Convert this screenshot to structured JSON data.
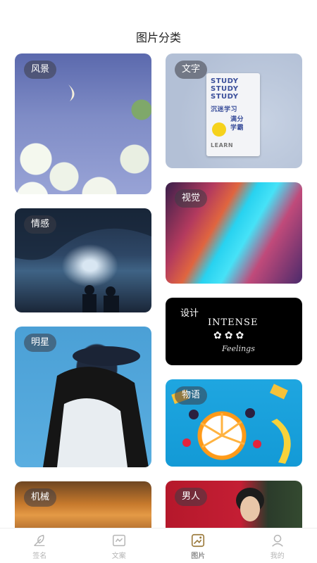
{
  "header": {
    "title": "图片分类"
  },
  "categories": [
    {
      "key": "fengjing",
      "label": "风景"
    },
    {
      "key": "wenzi",
      "label": "文字"
    },
    {
      "key": "qinggan",
      "label": "情感"
    },
    {
      "key": "shijue",
      "label": "视觉"
    },
    {
      "key": "mingxing",
      "label": "明星"
    },
    {
      "key": "sheji",
      "label": "设计"
    },
    {
      "key": "wuyu",
      "label": "物语"
    },
    {
      "key": "jixie",
      "label": "机械"
    },
    {
      "key": "nanren",
      "label": "男人"
    }
  ],
  "poster": {
    "line1": "STUDY",
    "line2": "STUDY",
    "line3": "STUDY",
    "side": "LEARN",
    "cn1": "沉迷学习",
    "cn2": "满分",
    "cn3": "学霸"
  },
  "design_card": {
    "title": "INTENSE",
    "daisies": "✿✿✿",
    "script": "Feelings"
  },
  "tabbar": {
    "items": [
      {
        "label": "签名",
        "icon": "feather-pen-icon",
        "active": false
      },
      {
        "label": "文案",
        "icon": "text-card-icon",
        "active": false
      },
      {
        "label": "图片",
        "icon": "image-icon",
        "active": true
      },
      {
        "label": "我的",
        "icon": "user-icon",
        "active": false
      }
    ]
  },
  "colors": {
    "active_tab_icon": "#9b7a3c",
    "inactive_tab": "#b5b5b5"
  }
}
